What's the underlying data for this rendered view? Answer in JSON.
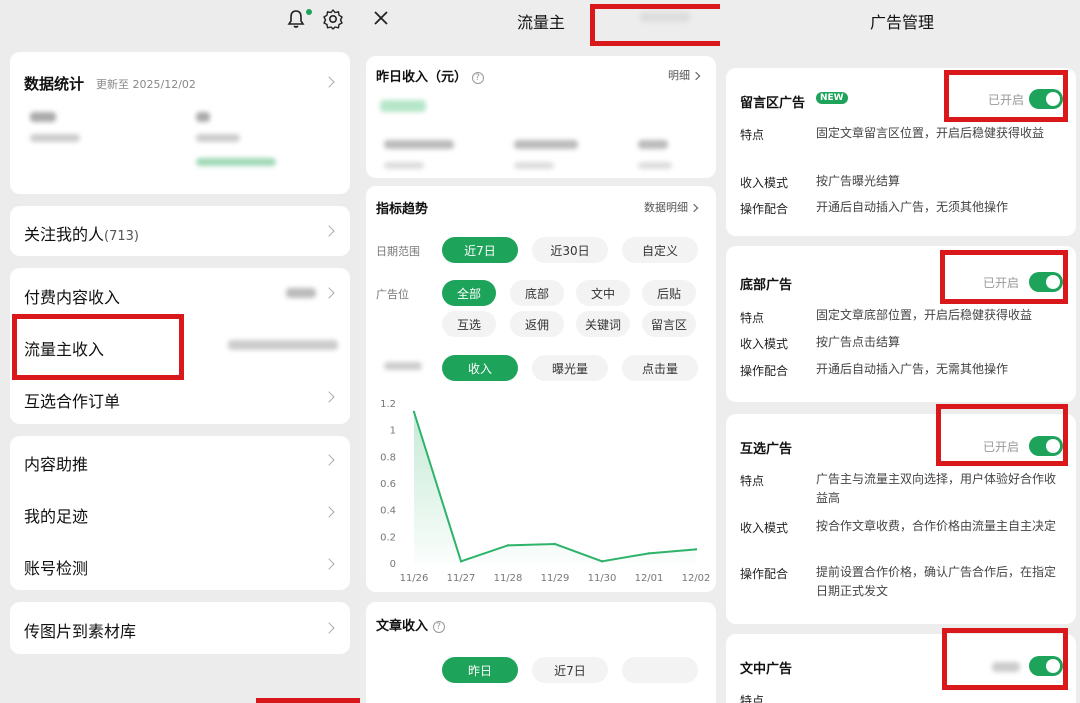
{
  "left": {
    "stats_title": "数据统计",
    "stats_updated": "更新至 2025/12/02",
    "followers_label": "关注我的人",
    "followers_count": "(713)",
    "menu_group1": [
      "付费内容收入",
      "流量主收入",
      "互选合作订单"
    ],
    "menu_group2": [
      "内容助推",
      "我的足迹",
      "账号检测"
    ],
    "upload_label": "传图片到素材库"
  },
  "middle": {
    "close_icon": "close-icon",
    "title": "流量主",
    "yesterday_title": "昨日收入（元）",
    "yesterday_detail": "明细",
    "trend_title": "指标趋势",
    "trend_detail": "数据明细",
    "date_range_label": "日期范围",
    "date_ranges": [
      "近7日",
      "近30日",
      "自定义"
    ],
    "ad_position_label": "广告位",
    "ad_positions_row1": [
      "全部",
      "底部",
      "文中",
      "后贴"
    ],
    "ad_positions_row2": [
      "互选",
      "返佣",
      "关键词",
      "留言区"
    ],
    "metrics": [
      "收入",
      "曝光量",
      "点击量"
    ],
    "article_income_title": "文章收入",
    "article_tabs": [
      "昨日",
      "近7日"
    ],
    "accent": "#1ea35a"
  },
  "chart_data": {
    "type": "line",
    "x": [
      "11/26",
      "11/27",
      "11/28",
      "11/29",
      "11/30",
      "12/01",
      "12/02"
    ],
    "values": [
      1.14,
      0.02,
      0.14,
      0.15,
      0.02,
      0.08,
      0.11
    ],
    "yticks": [
      "1.2",
      "1",
      "0.8",
      "0.6",
      "0.4",
      "0.2",
      "0"
    ],
    "ylim": [
      0,
      1.2
    ],
    "color": "#2fb36a"
  },
  "right": {
    "title": "广告管理",
    "k_feature": "特点",
    "k_mode": "收入模式",
    "k_operation": "操作配合",
    "enabled_text": "已开启",
    "new_badge": "NEW",
    "ads": [
      {
        "name": "留言区广告",
        "feature": "固定文章留言区位置，开启后稳健获得收益",
        "mode": "按广告曝光结算",
        "operation": "开通后自动插入广告，无须其他操作"
      },
      {
        "name": "底部广告",
        "feature": "固定文章底部位置，开启后稳健获得收益",
        "mode": "按广告点击结算",
        "operation": "开通后自动插入广告，无需其他操作"
      },
      {
        "name": "互选广告",
        "feature": "广告主与流量主双向选择，用户体验好合作收益高",
        "mode": "按合作文章收费，合作价格由流量主自主决定",
        "operation": "提前设置合作价格，确认广告合作后，在指定日期正式发文"
      },
      {
        "name": "文中广告"
      }
    ],
    "last_feature_partial": "特点"
  }
}
